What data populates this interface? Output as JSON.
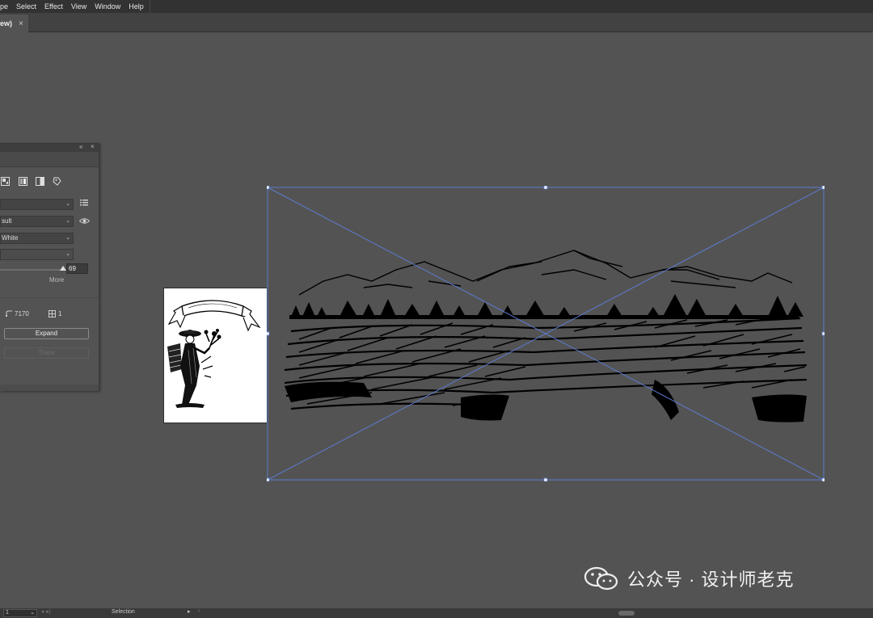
{
  "menubar": {
    "items": [
      "pe",
      "Select",
      "Effect",
      "View",
      "Window",
      "Help"
    ]
  },
  "document_tab": {
    "label": "ew)",
    "close_glyph": "×"
  },
  "image_trace_panel": {
    "collapse_glyph": "«",
    "close_glyph": "×",
    "preset_icons": [
      "auto-color-icon",
      "grayscale-icon",
      "black-white-icon",
      "outline-icon"
    ],
    "view_label": "sult",
    "mode_label": "White",
    "threshold_value": "69",
    "more_label": "More",
    "paths_value": "7170",
    "colors_value": "1",
    "expand_label": "Expand",
    "trace_label": "Trace"
  },
  "watermark": {
    "text": "公众号 · 设计师老克"
  },
  "statusbar": {
    "artboard_value": "1",
    "tool_label": "Selection"
  },
  "colors": {
    "canvas": "#535353",
    "selection": "#5b7ccf",
    "chrome_dark": "#323232"
  }
}
